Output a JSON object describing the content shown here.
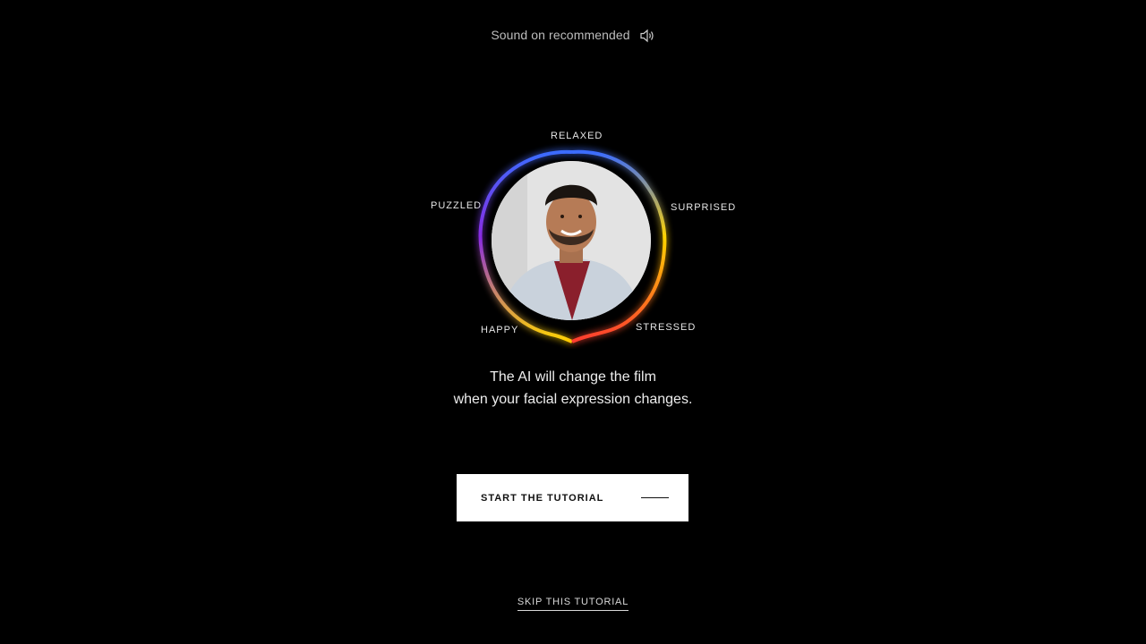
{
  "sound": {
    "text": "Sound on recommended",
    "icon": "speaker-icon"
  },
  "emotions": {
    "relaxed": "RELAXED",
    "surprised": "SURPRISED",
    "stressed": "STRESSED",
    "happy": "HAPPY",
    "puzzled": "PUZZLED"
  },
  "ring_colors": [
    "#3b6cff",
    "#8a2be2",
    "#ffd400",
    "#ff3b30",
    "#ff8a00"
  ],
  "instruction": {
    "line1": "The AI will change the film",
    "line2": "when your facial expression changes."
  },
  "start_button": {
    "label": "START THE TUTORIAL"
  },
  "skip_link": {
    "label": "SKIP THIS TUTORIAL"
  }
}
